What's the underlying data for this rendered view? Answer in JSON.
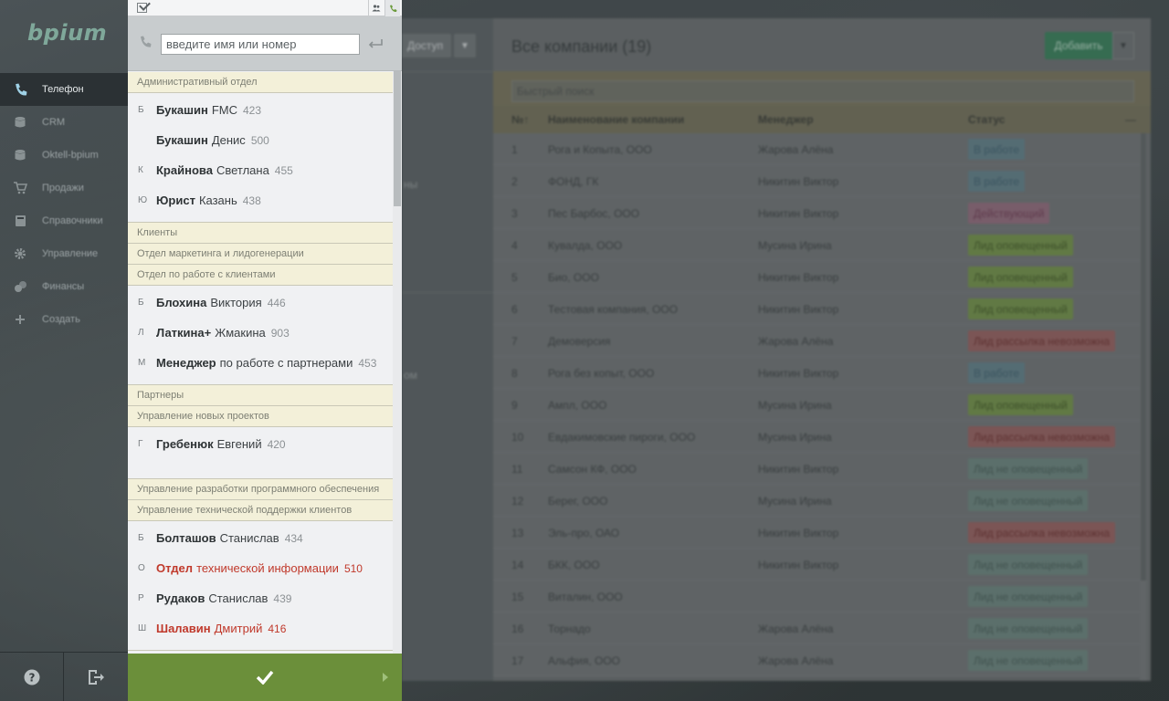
{
  "app": {
    "logo": "bpium"
  },
  "nav": {
    "items": [
      {
        "label": "Телефон",
        "icon": "phone-icon",
        "active": true
      },
      {
        "label": "CRM",
        "icon": "database-icon"
      },
      {
        "label": "Oktell-bpium",
        "icon": "database-icon"
      },
      {
        "label": "Продажи",
        "icon": "cart-icon"
      },
      {
        "label": "Справочники",
        "icon": "book-icon"
      },
      {
        "label": "Управление",
        "icon": "gear-icon"
      },
      {
        "label": "Финансы",
        "icon": "coins-icon"
      },
      {
        "label": "Создать",
        "icon": "plus-icon"
      }
    ],
    "help_icon": "help-icon",
    "logout_icon": "logout-icon"
  },
  "phone": {
    "search_placeholder": "введите имя или номер",
    "groups": [
      {
        "name": "Административный отдел",
        "contacts": [
          {
            "letter": "Б",
            "last": "Букашин",
            "first": "FMC",
            "ext": "423"
          },
          {
            "letter": "",
            "last": "Букашин",
            "first": "Денис",
            "ext": "500"
          },
          {
            "letter": "К",
            "last": "Крайнова",
            "first": "Светлана",
            "ext": "455"
          },
          {
            "letter": "Ю",
            "last": "Юрист",
            "first": "Казань",
            "ext": "438"
          }
        ]
      },
      {
        "name": "Клиенты",
        "contacts": []
      },
      {
        "name": "Отдел маркетинга и лидогенерации",
        "contacts": []
      },
      {
        "name": "Отдел по работе с клиентами",
        "contacts": [
          {
            "letter": "Б",
            "last": "Блохина",
            "first": "Виктория",
            "ext": "446"
          },
          {
            "letter": "Л",
            "last": "Латкина+",
            "first": "Жмакина",
            "ext": "903"
          },
          {
            "letter": "М",
            "last": "Менеджер",
            "first": "по работе с партнерами",
            "ext": "453"
          }
        ]
      },
      {
        "name": "Партнеры",
        "contacts": []
      },
      {
        "name": "Управление новых проектов",
        "contacts": [
          {
            "letter": "Г",
            "last": "Гребенюк",
            "first": "Евгений",
            "ext": "420"
          }
        ]
      },
      {
        "name": "Управление разработки программного обеспечения",
        "contacts": []
      },
      {
        "name": "Управление технической поддержки клиентов",
        "contacts": [
          {
            "letter": "Б",
            "last": "Болташов",
            "first": "Станислав",
            "ext": "434"
          },
          {
            "letter": "О",
            "last": "Отдел",
            "first": "технической информации",
            "ext": "510",
            "red": true
          },
          {
            "letter": "Р",
            "last": "Рудаков",
            "first": "Станислав",
            "ext": "439"
          },
          {
            "letter": "Ш",
            "last": "Шалавин",
            "first": "Дмитрий",
            "ext": "416",
            "red": true
          }
        ]
      }
    ]
  },
  "background": {
    "access_label": "Доступ",
    "title": "Все компании (19)",
    "add_label": "Добавить",
    "quick_search": "Быстрый поиск",
    "columns": [
      "№↑",
      "Наименование компании",
      "Менеджер",
      "Статус"
    ],
    "rows": [
      [
        "1",
        "Рога и Копыта, ООО",
        "Жарова Алёна",
        "В работе",
        "blue"
      ],
      [
        "2",
        "ФОНД, ГК",
        "Никитин Виктор",
        "В работе",
        "blue"
      ],
      [
        "3",
        "Пес Барбос, ООО",
        "Никитин Виктор",
        "Действующий",
        "pink"
      ],
      [
        "4",
        "Кувалда, ООО",
        "Мусина Ирина",
        "Лид оповещенный",
        "green"
      ],
      [
        "5",
        "Био, ООО",
        "Никитин Виктор",
        "Лид оповещенный",
        "green"
      ],
      [
        "6",
        "Тестовая компания, ООО",
        "Никитин Виктор",
        "Лид оповещенный",
        "green"
      ],
      [
        "7",
        "Демоверсия",
        "Жарова Алёна",
        "Лид рассылка невозможна",
        "red"
      ],
      [
        "8",
        "Рога без копыт, ООО",
        "Никитин Виктор",
        "В работе",
        "blue"
      ],
      [
        "9",
        "Ампл, ООО",
        "Мусина Ирина",
        "Лид оповещенный",
        "green"
      ],
      [
        "10",
        "Евдакимовские пироги, ООО",
        "Мусина Ирина",
        "Лид рассылка невозможна",
        "red"
      ],
      [
        "11",
        "Самсон КФ, ООО",
        "Никитин Виктор",
        "Лид не оповещенный",
        "mint"
      ],
      [
        "12",
        "Берег, ООО",
        "Мусина Ирина",
        "Лид не оповещенный",
        "mint"
      ],
      [
        "13",
        "Эль-про, ОАО",
        "Никитин Виктор",
        "Лид рассылка невозможна",
        "red"
      ],
      [
        "14",
        "БКК, ООО",
        "Никитин Виктор",
        "Лид не оповещенный",
        "mint"
      ],
      [
        "15",
        "Виталин, ООО",
        "",
        "Лид не оповещенный",
        "mint"
      ],
      [
        "16",
        "Торнадо",
        "Жарова Алёна",
        "Лид не оповещенный",
        "mint"
      ],
      [
        "17",
        "Альфия, ООО",
        "Жарова Алёна",
        "Лид не оповещенный",
        "mint"
      ]
    ]
  }
}
